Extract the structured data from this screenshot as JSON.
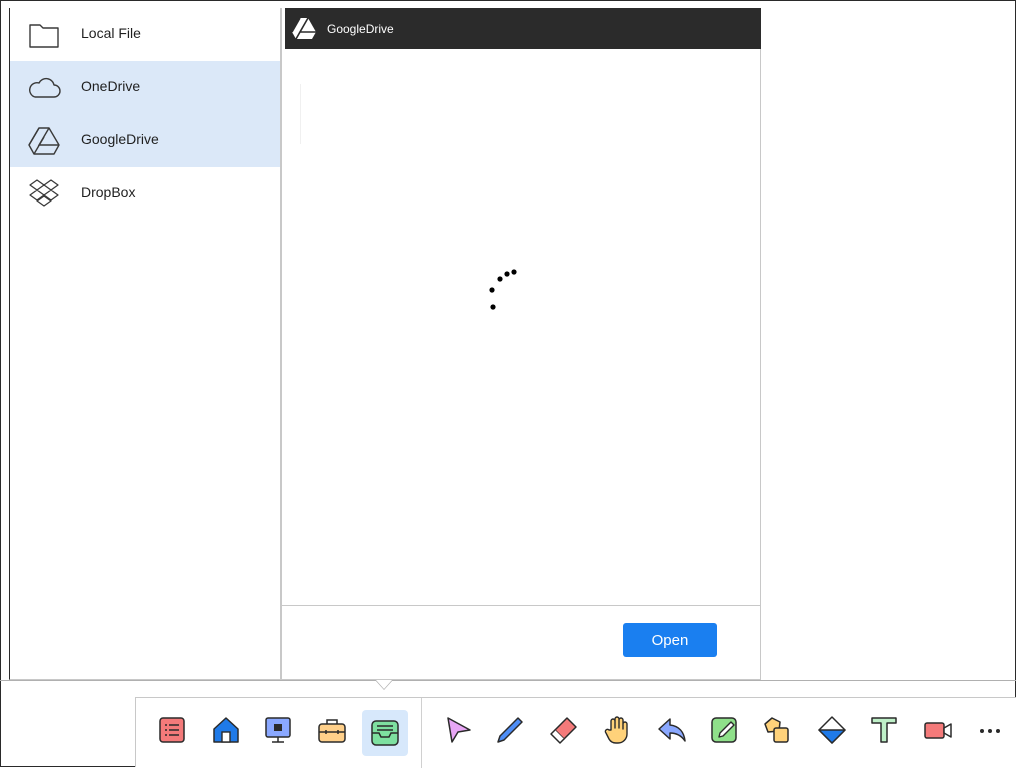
{
  "sources": {
    "items": [
      {
        "label": "Local File",
        "icon": "folder-icon",
        "active": false
      },
      {
        "label": "OneDrive",
        "icon": "cloud-icon",
        "active": true
      },
      {
        "label": "GoogleDrive",
        "icon": "google-drive-icon",
        "active": true
      },
      {
        "label": "DropBox",
        "icon": "dropbox-icon",
        "active": false
      }
    ]
  },
  "viewer": {
    "header_title": "GoogleDrive",
    "open_label": "Open"
  },
  "colors": {
    "accent": "#1a7ff0",
    "selected_bg": "#dbe8f8",
    "header_bg": "#2b2b2b"
  },
  "toolbar": {
    "tools": [
      {
        "icon": "list-menu-icon"
      },
      {
        "icon": "home-icon"
      },
      {
        "icon": "screen-icon"
      },
      {
        "icon": "toolbox-icon"
      },
      {
        "icon": "file-tray-icon",
        "active": true
      },
      {
        "icon": "select-arrow-icon"
      },
      {
        "icon": "pen-icon"
      },
      {
        "icon": "eraser-icon"
      },
      {
        "icon": "hand-icon"
      },
      {
        "icon": "undo-icon"
      },
      {
        "icon": "note-icon"
      },
      {
        "icon": "shapes-icon"
      },
      {
        "icon": "fill-icon"
      },
      {
        "icon": "text-icon"
      },
      {
        "icon": "camera-icon"
      },
      {
        "icon": "more-icon"
      }
    ]
  }
}
